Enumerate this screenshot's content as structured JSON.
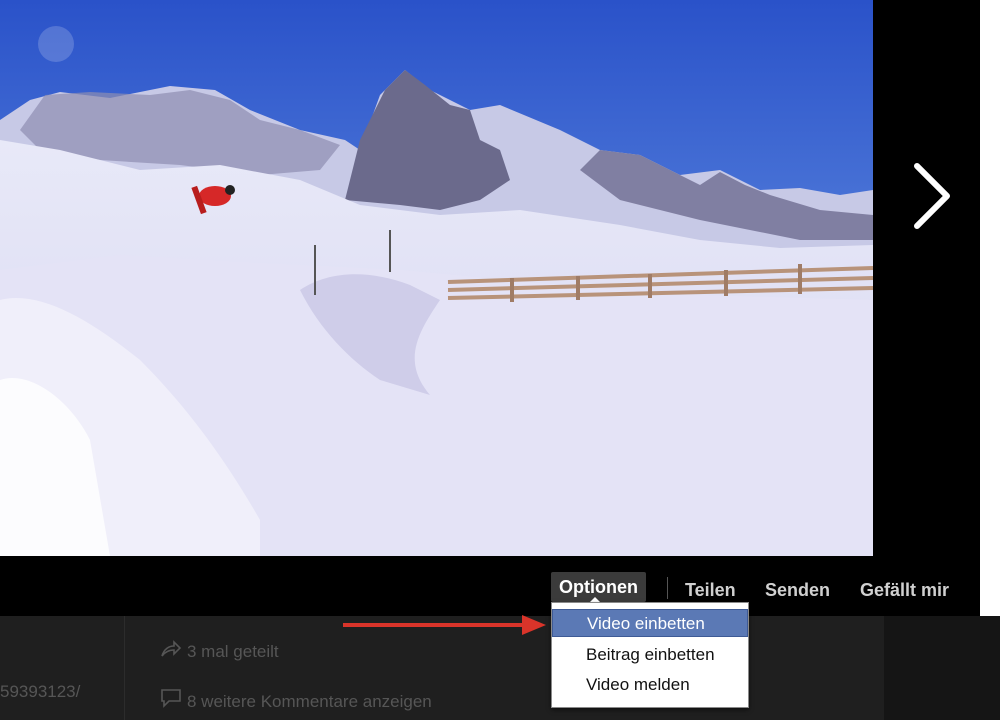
{
  "actions": {
    "options_label": "Optionen",
    "share_label": "Teilen",
    "send_label": "Senden",
    "like_label": "Gefällt mir"
  },
  "dropdown": {
    "items": [
      {
        "label": "Video einbetten",
        "active": true
      },
      {
        "label": "Beitrag einbetten",
        "active": false
      },
      {
        "label": "Video melden",
        "active": false
      }
    ]
  },
  "comments": {
    "shares_text": "3 mal geteilt",
    "more_comments_text": "8 weitere Kommentare anzeigen",
    "link_fragment": "59393123/"
  },
  "colors": {
    "annotation_arrow": "#d9342a",
    "dropdown_highlight": "#5b79b5"
  },
  "icons": {
    "next": "chevron-right-icon",
    "share": "share-arrow-icon",
    "comment": "comment-bubble-icon"
  }
}
